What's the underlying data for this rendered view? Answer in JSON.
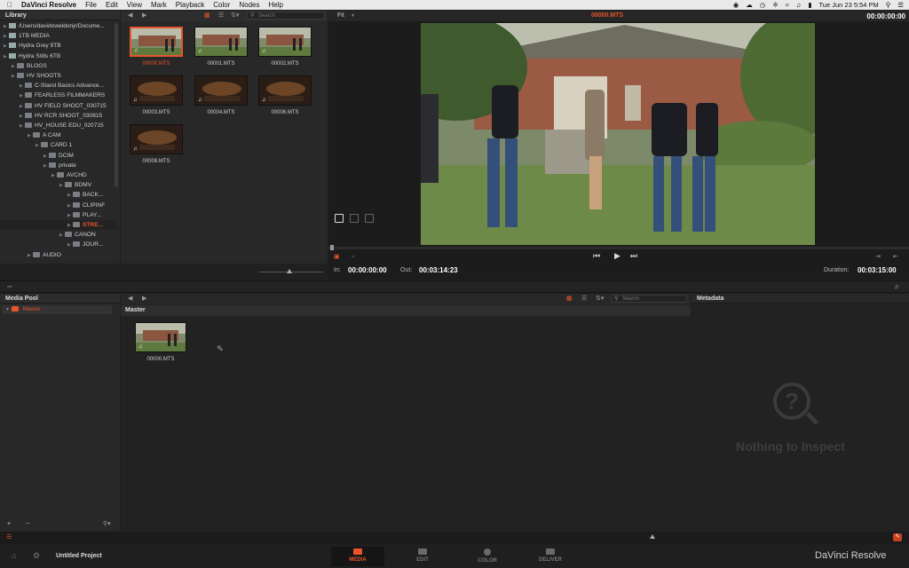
{
  "menubar": {
    "app_name": "DaVinci Resolve",
    "items": [
      "File",
      "Edit",
      "View",
      "Mark",
      "Playback",
      "Color",
      "Nodes",
      "Help"
    ],
    "clock": "Tue Jun 23  5:54 PM"
  },
  "library": {
    "title": "Library",
    "rows": [
      {
        "label": "/Users/davidoweldonjr/Docume...",
        "indent": 0,
        "type": "drive"
      },
      {
        "label": "1TB MEDIA",
        "indent": 0,
        "type": "drive"
      },
      {
        "label": "Hydra Grey 9TB",
        "indent": 0,
        "type": "drive"
      },
      {
        "label": "Hydra Stills 6TB",
        "indent": 0,
        "type": "drive"
      },
      {
        "label": "BLOGS",
        "indent": 1,
        "type": "folder"
      },
      {
        "label": "HV SHOOTS",
        "indent": 1,
        "type": "folder"
      },
      {
        "label": "C-Stand Basics Advance...",
        "indent": 2,
        "type": "folder"
      },
      {
        "label": "FEARLESS FILMMAKERS",
        "indent": 2,
        "type": "folder"
      },
      {
        "label": "HV FIELD SHOOT_030715",
        "indent": 2,
        "type": "folder"
      },
      {
        "label": "HV RCR SHOOT_030815",
        "indent": 2,
        "type": "folder"
      },
      {
        "label": "HV_HOUSE EDU_020715",
        "indent": 2,
        "type": "folder"
      },
      {
        "label": "A CAM",
        "indent": 3,
        "type": "folder"
      },
      {
        "label": "CARD 1",
        "indent": 4,
        "type": "folder"
      },
      {
        "label": "DCIM",
        "indent": 5,
        "type": "folder"
      },
      {
        "label": "private",
        "indent": 5,
        "type": "folder"
      },
      {
        "label": "AVCHD",
        "indent": 6,
        "type": "folder"
      },
      {
        "label": "BDMV",
        "indent": 7,
        "type": "folder"
      },
      {
        "label": "BACK...",
        "indent": 8,
        "type": "folder"
      },
      {
        "label": "CLIPINF",
        "indent": 8,
        "type": "folder"
      },
      {
        "label": "PLAY...",
        "indent": 8,
        "type": "folder"
      },
      {
        "label": "STRE...",
        "indent": 8,
        "type": "folder",
        "selected": true
      },
      {
        "label": "CANON",
        "indent": 7,
        "type": "folder"
      },
      {
        "label": "JOUR...",
        "indent": 8,
        "type": "folder"
      },
      {
        "label": "AUDIO",
        "indent": 3,
        "type": "folder"
      }
    ]
  },
  "browser": {
    "search_placeholder": "Search",
    "clips": [
      {
        "name": "00000.MTS",
        "selected": true,
        "tone": "day"
      },
      {
        "name": "00001.MTS",
        "tone": "day"
      },
      {
        "name": "00002.MTS",
        "tone": "day"
      },
      {
        "name": "00003.MTS",
        "tone": "night"
      },
      {
        "name": "00004.MTS",
        "tone": "night"
      },
      {
        "name": "00006.MTS",
        "tone": "night"
      },
      {
        "name": "00008.MTS",
        "tone": "night"
      }
    ]
  },
  "viewer": {
    "fit_label": "Fit",
    "clip_name": "00000.MTS",
    "top_timecode": "00:00:00:00",
    "in_label": "In:",
    "in_value": "00:00:00:00",
    "out_label": "Out:",
    "out_value": "00:03:14:23",
    "duration_label": "Duration:",
    "duration_value": "00:03:15:00"
  },
  "media_pool": {
    "title": "Media Pool",
    "master_label": "Master",
    "bin_header": "Master",
    "search_placeholder": "Search",
    "clips": [
      {
        "name": "00000.MTS"
      }
    ]
  },
  "metadata": {
    "title": "Metadata",
    "empty_text": "Nothing to Inspect"
  },
  "bottom": {
    "project_name": "Untitled Project",
    "brand": "DaVinci Resolve",
    "tabs": [
      {
        "label": "MEDIA",
        "active": true
      },
      {
        "label": "EDIT"
      },
      {
        "label": "COLOR"
      },
      {
        "label": "DELIVER"
      }
    ]
  },
  "colors": {
    "accent": "#e8542c",
    "panel": "#282828",
    "background": "#1e1e1e"
  }
}
